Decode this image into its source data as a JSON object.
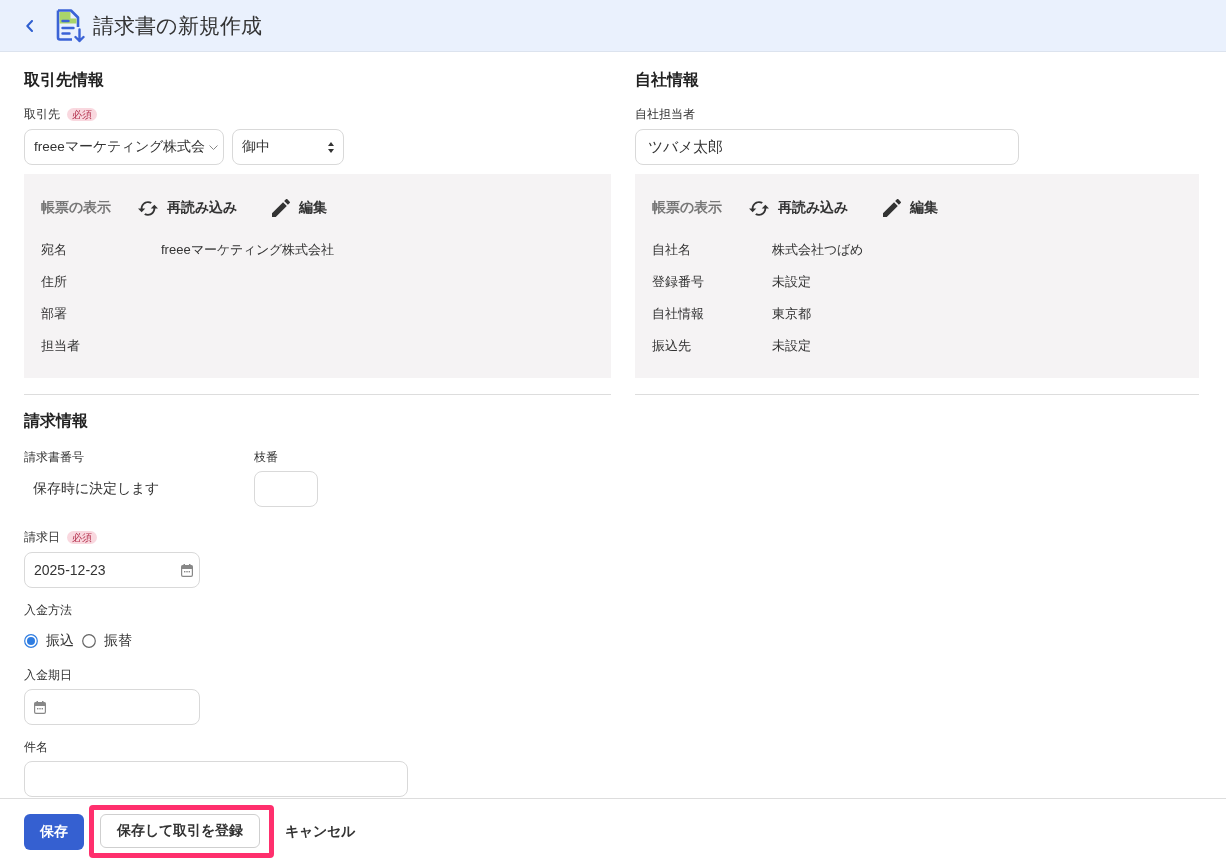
{
  "header": {
    "title": "請求書の新規作成"
  },
  "client_section": {
    "heading": "取引先情報",
    "client": {
      "label": "取引先",
      "required_badge": "必須",
      "value": "freeeマーケティング株式会"
    },
    "honorific": {
      "value": "御中"
    },
    "preview": {
      "title": "帳票の表示",
      "actions": [
        {
          "kind": "reload",
          "label": "再読み込み"
        },
        {
          "kind": "edit",
          "label": "編集"
        }
      ],
      "rows": [
        {
          "label": "宛名",
          "value": "freeeマーケティング株式会社"
        },
        {
          "label": "住所"
        },
        {
          "label": "部署"
        },
        {
          "label": "担当者"
        }
      ]
    }
  },
  "company_section": {
    "heading": "自社情報",
    "staff": {
      "label": "自社担当者",
      "value": "ツバメ太郎"
    },
    "preview": {
      "title": "帳票の表示",
      "actions": [
        {
          "kind": "reload",
          "label": "再読み込み"
        },
        {
          "kind": "edit",
          "label": "編集"
        }
      ],
      "rows": [
        {
          "label": "自社名",
          "value": "株式会社つばめ"
        },
        {
          "label": "登録番号",
          "value": "未設定"
        },
        {
          "label": "自社情報",
          "value": "東京都"
        },
        {
          "label": "振込先",
          "value": "未設定"
        }
      ]
    }
  },
  "billing_section": {
    "heading": "請求情報",
    "invoice_number": {
      "label": "請求書番号",
      "value": "保存時に決定します"
    },
    "branch_number": {
      "label": "枝番"
    },
    "invoice_date": {
      "label": "請求日",
      "required_badge": "必須",
      "value": "2025-12-23"
    },
    "payment_method": {
      "label": "入金方法",
      "options": [
        {
          "label": "振込",
          "selected": true
        },
        {
          "label": "振替",
          "selected": false
        }
      ]
    },
    "payment_due_date": {
      "label": "入金期日"
    },
    "subject": {
      "label": "件名"
    }
  },
  "footer": {
    "buttons": [
      {
        "label": "保存",
        "kind": "primary",
        "highlighted": false
      },
      {
        "label": "保存して取引を登録",
        "kind": "secondary",
        "highlighted": true
      },
      {
        "label": "キャンセル",
        "kind": "text",
        "highlighted": false
      }
    ]
  }
}
